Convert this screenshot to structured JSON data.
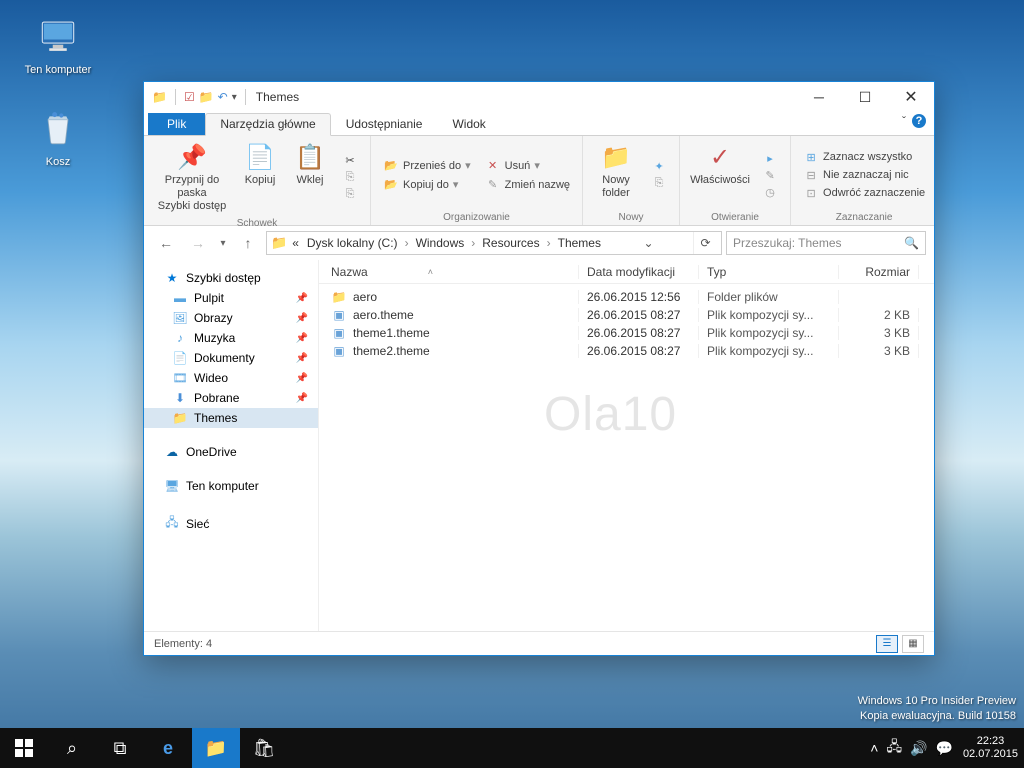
{
  "desktop_icons": {
    "this_pc": "Ten komputer",
    "recycle_bin": "Kosz"
  },
  "window": {
    "title": "Themes",
    "tabs": {
      "file": "Plik",
      "home": "Narzędzia główne",
      "share": "Udostępnianie",
      "view": "Widok"
    },
    "ribbon": {
      "clipboard": {
        "pin": "Przypnij do paska\nSzybki dostęp",
        "copy": "Kopiuj",
        "paste": "Wklej",
        "title": "Schowek"
      },
      "organize": {
        "move_to": "Przenieś do",
        "copy_to": "Kopiuj do",
        "delete": "Usuń",
        "rename": "Zmień nazwę",
        "title": "Organizowanie"
      },
      "new": {
        "folder": "Nowy\nfolder",
        "title": "Nowy"
      },
      "open": {
        "properties": "Właściwości",
        "title": "Otwieranie"
      },
      "select": {
        "all": "Zaznacz wszystko",
        "none": "Nie zaznaczaj nic",
        "invert": "Odwróć zaznaczenie",
        "title": "Zaznaczanie"
      }
    },
    "breadcrumb": {
      "prefix": "«",
      "items": [
        "Dysk lokalny (C:)",
        "Windows",
        "Resources",
        "Themes"
      ]
    },
    "search_placeholder": "Przeszukaj: Themes",
    "sidebar": {
      "quick_access": "Szybki dostęp",
      "desktop": "Pulpit",
      "pictures": "Obrazy",
      "music": "Muzyka",
      "documents": "Dokumenty",
      "videos": "Wideo",
      "downloads": "Pobrane",
      "themes": "Themes",
      "onedrive": "OneDrive",
      "this_pc": "Ten komputer",
      "network": "Sieć"
    },
    "columns": {
      "name": "Nazwa",
      "date": "Data modyfikacji",
      "type": "Typ",
      "size": "Rozmiar"
    },
    "files": [
      {
        "icon": "folder",
        "name": "aero",
        "date": "26.06.2015 12:56",
        "type": "Folder plików",
        "size": ""
      },
      {
        "icon": "theme",
        "name": "aero.theme",
        "date": "26.06.2015 08:27",
        "type": "Plik kompozycji sy...",
        "size": "2 KB"
      },
      {
        "icon": "theme",
        "name": "theme1.theme",
        "date": "26.06.2015 08:27",
        "type": "Plik kompozycji sy...",
        "size": "3 KB"
      },
      {
        "icon": "theme",
        "name": "theme2.theme",
        "date": "26.06.2015 08:27",
        "type": "Plik kompozycji sy...",
        "size": "3 KB"
      }
    ],
    "statusbar": "Elementy: 4"
  },
  "build_info": {
    "line1": "Windows 10 Pro Insider Preview",
    "line2": "Kopia ewaluacyjna. Build 10158"
  },
  "tray": {
    "time": "22:23",
    "date": "02.07.2015"
  },
  "watermark": "Ola10"
}
